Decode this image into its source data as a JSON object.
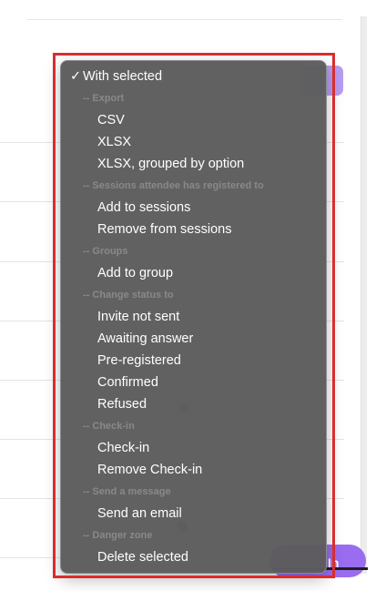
{
  "background": {
    "login_button_label": "In",
    "accent_color": "#9a6cf0"
  },
  "menu": {
    "selected_label": "With selected",
    "checkmark": "✓",
    "groups": {
      "export": "-- Export",
      "sessions": "-- Sessions attendee has registered to",
      "groups": "-- Groups",
      "change_status": "-- Change status to",
      "check_in": "-- Check-in",
      "send_message": "-- Send a message",
      "danger_zone": "-- Danger zone"
    },
    "items": {
      "csv": "CSV",
      "xlsx": "XLSX",
      "xlsx_grouped": "XLSX, grouped by option",
      "add_to_sessions": "Add to sessions",
      "remove_from_sessions": "Remove from sessions",
      "add_to_group": "Add to group",
      "invite_not_sent": "Invite not sent",
      "awaiting_answer": "Awaiting answer",
      "pre_registered": "Pre-registered",
      "confirmed": "Confirmed",
      "refused": "Refused",
      "check_in": "Check-in",
      "remove_check_in": "Remove Check-in",
      "send_email": "Send an email",
      "delete_selected": "Delete selected"
    }
  }
}
